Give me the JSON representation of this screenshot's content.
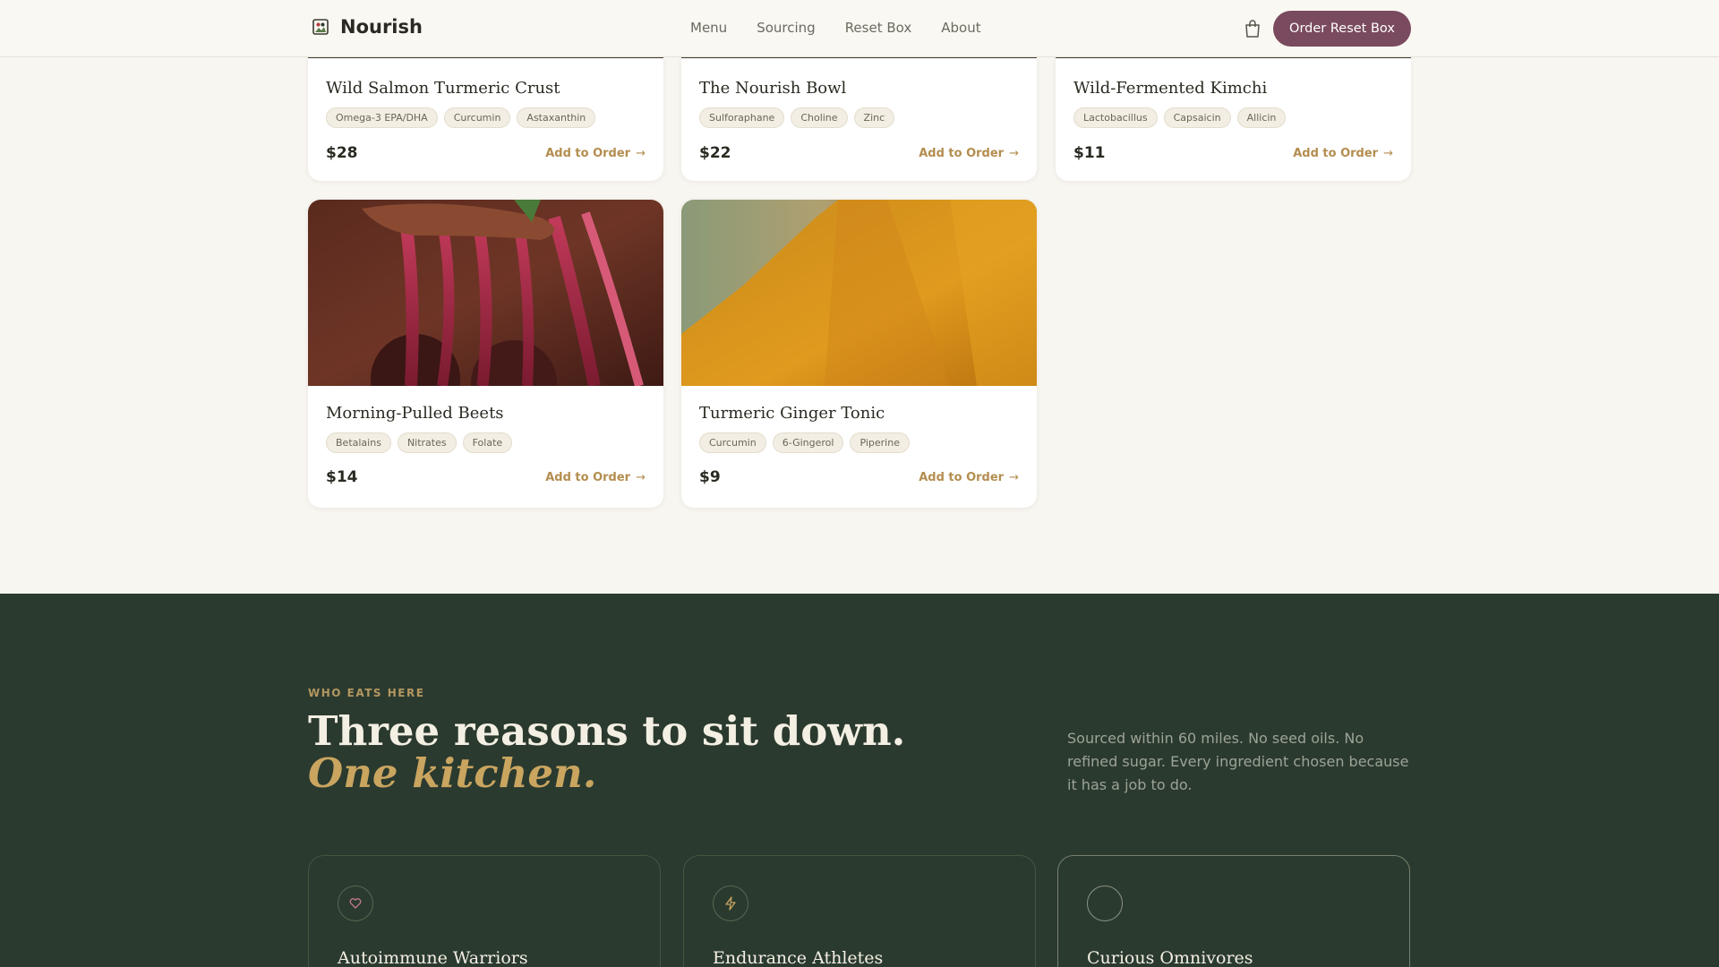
{
  "header": {
    "brand": "Nourish",
    "nav": [
      "Menu",
      "Sourcing",
      "Reset Box",
      "About"
    ],
    "cta": "Order Reset Box"
  },
  "menu_items": [
    {
      "name": "Wild Salmon Turmeric Crust",
      "tags": [
        "Omega-3 EPA/DHA",
        "Curcumin",
        "Astaxanthin"
      ],
      "price": "$28",
      "action": "Add to Order"
    },
    {
      "name": "The Nourish Bowl",
      "tags": [
        "Sulforaphane",
        "Choline",
        "Zinc"
      ],
      "price": "$22",
      "action": "Add to Order"
    },
    {
      "name": "Wild-Fermented Kimchi",
      "tags": [
        "Lactobacillus",
        "Capsaicin",
        "Allicin"
      ],
      "price": "$11",
      "action": "Add to Order"
    },
    {
      "name": "Morning-Pulled Beets",
      "tags": [
        "Betalains",
        "Nitrates",
        "Folate"
      ],
      "price": "$14",
      "action": "Add to Order"
    },
    {
      "name": "Turmeric Ginger Tonic",
      "tags": [
        "Curcumin",
        "6-Gingerol",
        "Piperine"
      ],
      "price": "$9",
      "action": "Add to Order"
    }
  ],
  "who": {
    "eyebrow": "WHO EATS HERE",
    "headline": "Three reasons to sit down.",
    "headline_accent": "One kitchen.",
    "intro": "Sourced within 60 miles. No seed oils. No refined sugar. Every ingredient chosen because it has a job to do.",
    "cards": [
      {
        "icon": "heart-icon",
        "title": "Autoimmune Warriors"
      },
      {
        "icon": "lightning-icon",
        "title": "Endurance Athletes"
      },
      {
        "icon": "circle-icon",
        "title": "Curious Omnivores"
      }
    ]
  },
  "colors": {
    "cream": "#f8f6f1",
    "plum": "#7a4a5f",
    "gold": "#b38d4f",
    "forest": "#2b3a2f"
  }
}
